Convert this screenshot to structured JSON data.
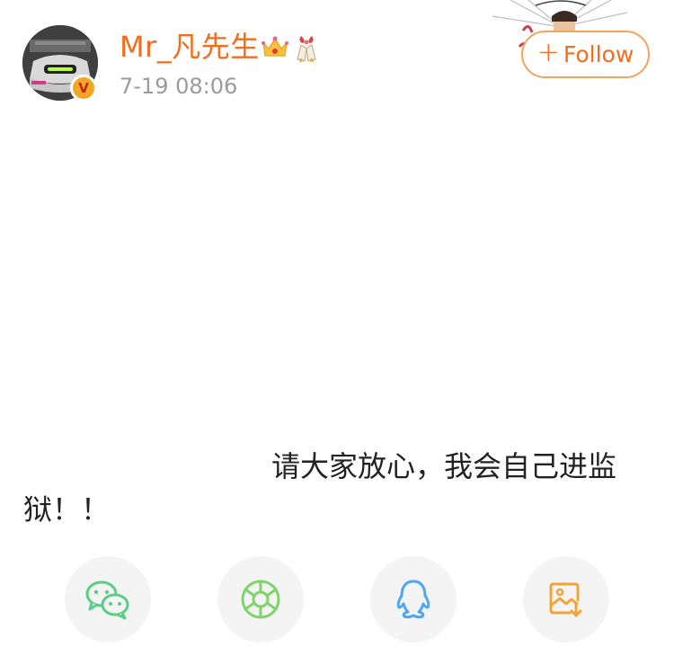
{
  "post": {
    "author": {
      "username": "Mr_凡先生",
      "avatar_icon": "avatar-car-photo",
      "verified_badge": "V",
      "badge_icons": [
        "crown-icon",
        "bells-icon"
      ]
    },
    "timestamp": "7-19 08:06",
    "follow_button": {
      "plus": "+",
      "label": "Follow"
    },
    "text": "请大家放心，我会自己进监狱！！"
  },
  "share": [
    {
      "name": "wechat",
      "icon": "wechat-icon",
      "color": "#5ccd86"
    },
    {
      "name": "moments",
      "icon": "moments-icon",
      "color": "#7ed36a"
    },
    {
      "name": "qq",
      "icon": "qq-icon",
      "color": "#4ea7f2"
    },
    {
      "name": "save-image",
      "icon": "save-image-icon",
      "color": "#f2a43a"
    }
  ],
  "colors": {
    "accent": "#f26d1d",
    "follow_border": "#f6a35b",
    "timestamp": "#9b9b9b",
    "text": "#222222",
    "share_bg": "#f4f4f4"
  }
}
